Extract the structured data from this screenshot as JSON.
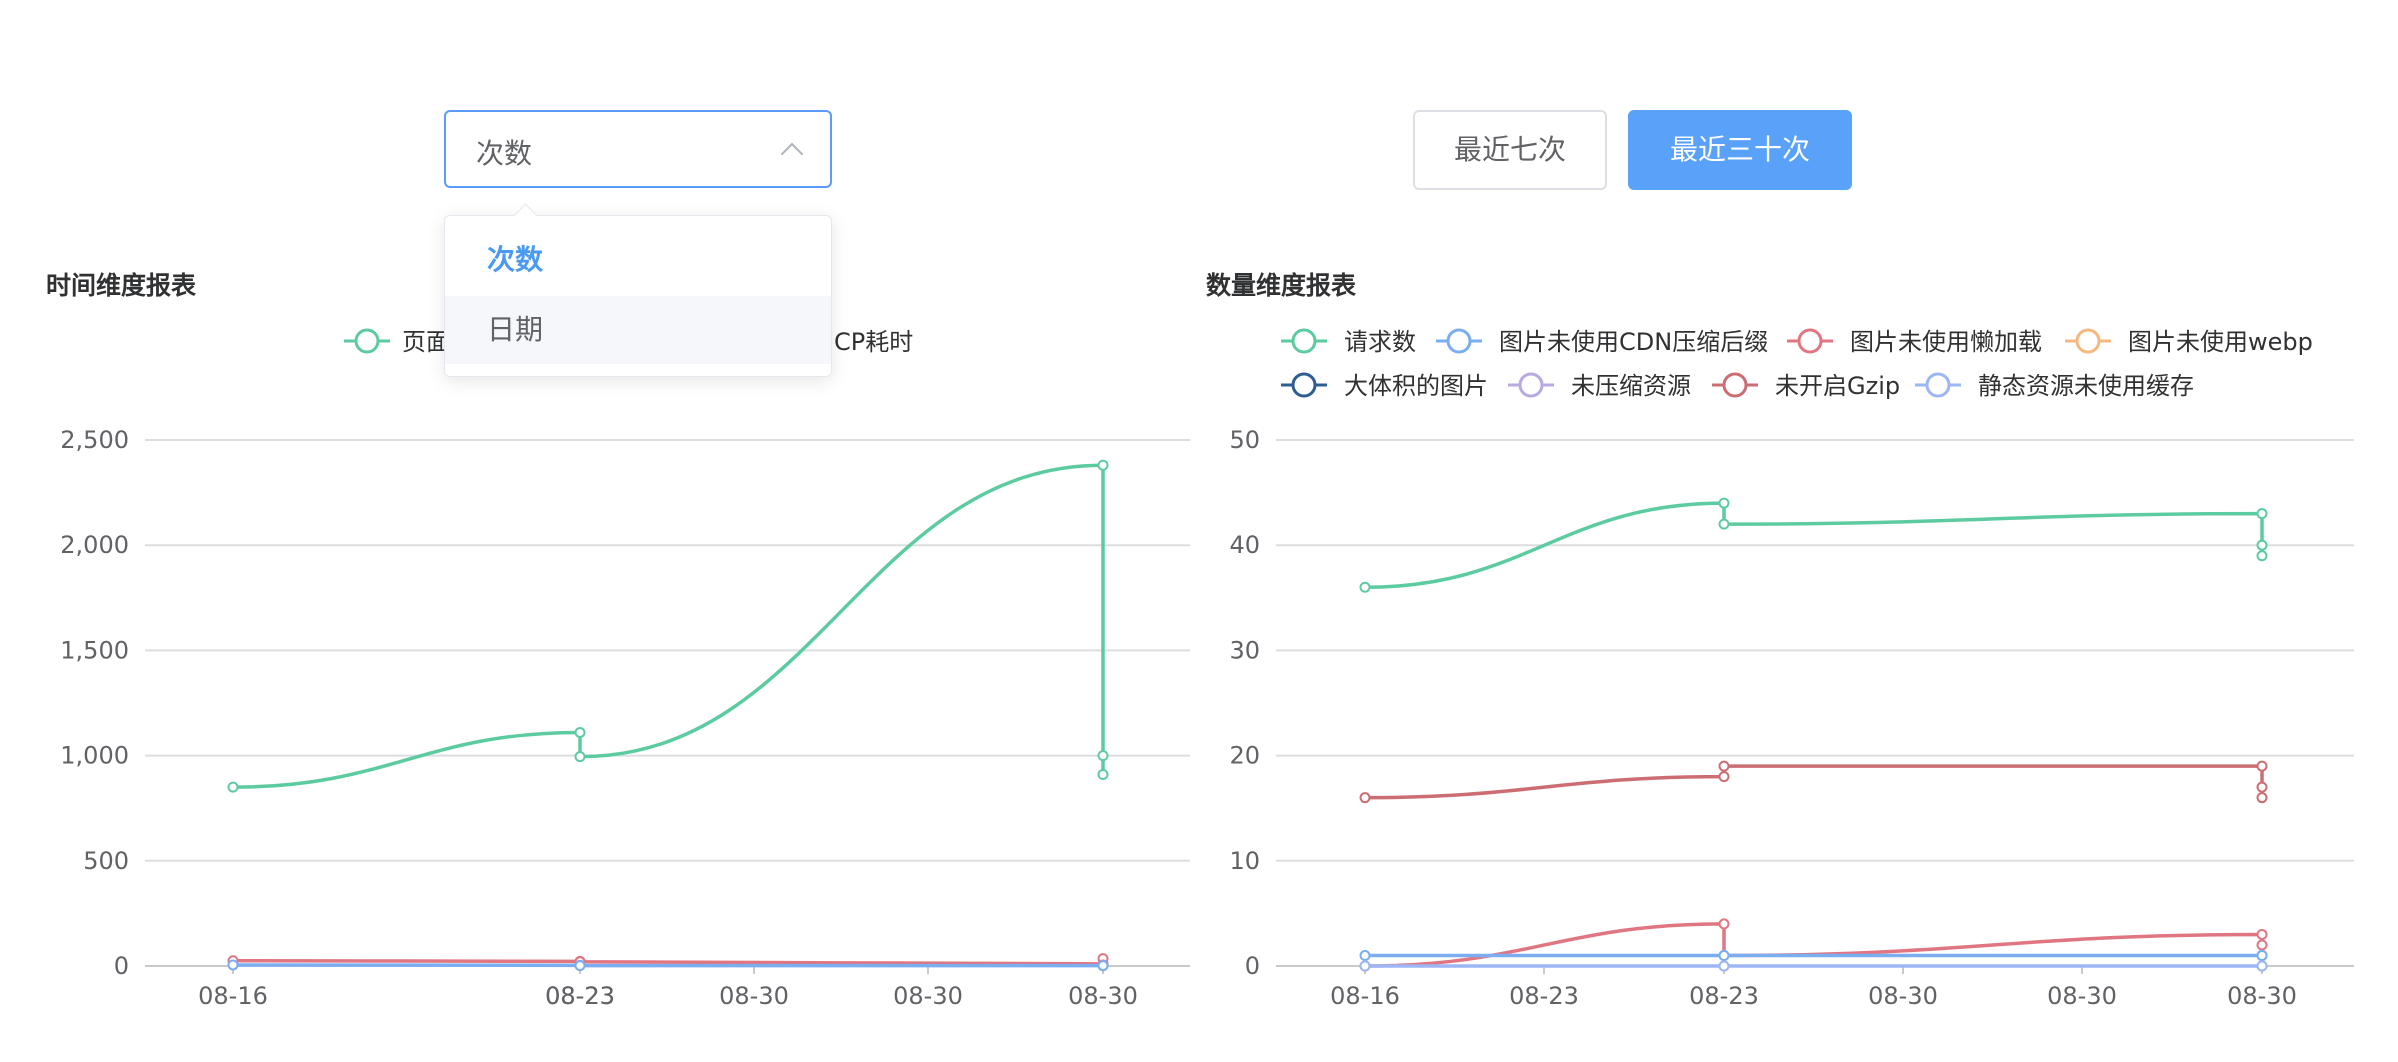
{
  "select": {
    "value": "次数",
    "options": [
      "次数",
      "日期"
    ]
  },
  "buttons": {
    "last7": "最近七次",
    "last30": "最近三十次"
  },
  "colors": {
    "accent": "#5aa2f9",
    "green": "#5ccba0",
    "red": "#e07682",
    "blue": "#7aaef0"
  },
  "chart_data": [
    {
      "type": "line",
      "title": "时间维度报表",
      "x": [
        "08-16",
        "08-23",
        "08-23",
        "08-30",
        "08-30",
        "08-30"
      ],
      "xlabel": "",
      "ylabel": "",
      "ylim": [
        0,
        2500
      ],
      "yticks": [
        "0",
        "500",
        "1,000",
        "1,500",
        "2,000",
        "2,500"
      ],
      "grid": true,
      "legend_visible": [
        "页面",
        "CP耗时"
      ],
      "series": [
        {
          "name": "",
          "color": "#5ccba0",
          "values": [
            850,
            1110,
            995,
            2380,
            1000,
            910
          ]
        },
        {
          "name": "",
          "color": "#e07682",
          "values": [
            25,
            22,
            20,
            10,
            35,
            5
          ]
        },
        {
          "name": "",
          "color": "#7aaef0",
          "values": [
            5,
            3,
            2,
            2,
            2,
            2
          ]
        }
      ]
    },
    {
      "type": "line",
      "title": "数量维度报表",
      "x": [
        "08-16",
        "08-23",
        "08-23",
        "08-30",
        "08-30",
        "08-30"
      ],
      "xlabel": "",
      "ylabel": "",
      "ylim": [
        0,
        50
      ],
      "yticks": [
        "0",
        "10",
        "20",
        "30",
        "40",
        "50"
      ],
      "grid": true,
      "legend": [
        {
          "name": "请求数",
          "color": "#5ccba0"
        },
        {
          "name": "图片未使用CDN压缩后缀",
          "color": "#7aaef0"
        },
        {
          "name": "图片未使用懒加载",
          "color": "#e07682"
        },
        {
          "name": "图片未使用webp",
          "color": "#f3b97f"
        },
        {
          "name": "大体积的图片",
          "color": "#2e5e91"
        },
        {
          "name": "未压缩资源",
          "color": "#b9a9e3"
        },
        {
          "name": "未开启Gzip",
          "color": "#cc6d74"
        },
        {
          "name": "静态资源未使用缓存",
          "color": "#9db6f5"
        }
      ],
      "series": [
        {
          "name": "请求数",
          "color": "#5ccba0",
          "values": [
            36,
            44,
            42,
            43,
            40,
            39
          ]
        },
        {
          "name": "未开启Gzip",
          "color": "#cc6d74",
          "values": [
            16,
            18,
            19,
            19,
            17,
            16
          ]
        },
        {
          "name": "图片未使用懒加载",
          "color": "#e07682",
          "values": [
            0,
            4,
            1,
            3,
            2,
            1
          ]
        },
        {
          "name": "图片未使用CDN压缩后缀",
          "color": "#7aaef0",
          "values": [
            1,
            1,
            1,
            1,
            1,
            1
          ]
        },
        {
          "name": "静态资源未使用缓存",
          "color": "#9db6f5",
          "values": [
            0,
            0,
            0,
            0,
            0,
            0
          ]
        }
      ]
    }
  ]
}
